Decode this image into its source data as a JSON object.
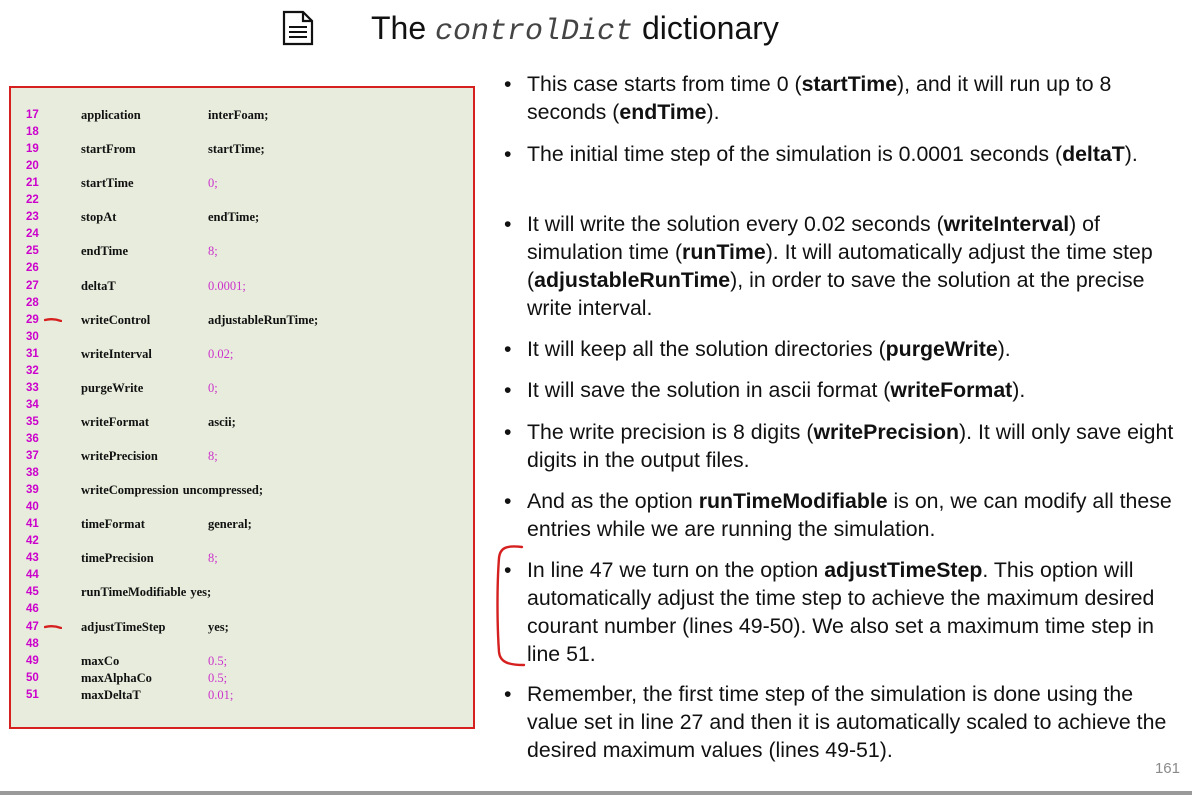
{
  "title": {
    "prefix": "The",
    "mono": "controlDict",
    "suffix": "dictionary"
  },
  "icons": {
    "title_icon": "document-icon"
  },
  "colors": {
    "accent_border": "#d62020",
    "line_number": "#cc00cc",
    "numeric_value": "#cc33cc",
    "code_background": "#e7ecdc"
  },
  "code": [
    {
      "n": "17",
      "key": "application",
      "value": "interFoam;",
      "numeric": false
    },
    {
      "n": "18",
      "key": "",
      "value": "",
      "numeric": false
    },
    {
      "n": "19",
      "key": "startFrom",
      "value": "startTime;",
      "numeric": false
    },
    {
      "n": "20",
      "key": "",
      "value": "",
      "numeric": false
    },
    {
      "n": "21",
      "key": "startTime",
      "value": "0;",
      "numeric": true
    },
    {
      "n": "22",
      "key": "",
      "value": "",
      "numeric": false
    },
    {
      "n": "23",
      "key": "stopAt",
      "value": "endTime;",
      "numeric": false
    },
    {
      "n": "24",
      "key": "",
      "value": "",
      "numeric": false
    },
    {
      "n": "25",
      "key": "endTime",
      "value": "8;",
      "numeric": true
    },
    {
      "n": "26",
      "key": "",
      "value": "",
      "numeric": false
    },
    {
      "n": "27",
      "key": "deltaT",
      "value": "0.0001;",
      "numeric": true
    },
    {
      "n": "28",
      "key": "",
      "value": "",
      "numeric": false
    },
    {
      "n": "29",
      "key": "writeControl",
      "value": "adjustableRunTime;",
      "numeric": false,
      "marked": true
    },
    {
      "n": "30",
      "key": "",
      "value": "",
      "numeric": false
    },
    {
      "n": "31",
      "key": "writeInterval",
      "value": "0.02;",
      "numeric": true
    },
    {
      "n": "32",
      "key": "",
      "value": "",
      "numeric": false
    },
    {
      "n": "33",
      "key": "purgeWrite",
      "value": "0;",
      "numeric": true
    },
    {
      "n": "34",
      "key": "",
      "value": "",
      "numeric": false
    },
    {
      "n": "35",
      "key": "writeFormat",
      "value": "ascii;",
      "numeric": false
    },
    {
      "n": "36",
      "key": "",
      "value": "",
      "numeric": false
    },
    {
      "n": "37",
      "key": "writePrecision",
      "value": "8;",
      "numeric": true
    },
    {
      "n": "38",
      "key": "",
      "value": "",
      "numeric": false
    },
    {
      "n": "39",
      "key": "writeCompression",
      "value": "uncompressed;",
      "numeric": false,
      "inline": true
    },
    {
      "n": "40",
      "key": "",
      "value": "",
      "numeric": false
    },
    {
      "n": "41",
      "key": "timeFormat",
      "value": "general;",
      "numeric": false
    },
    {
      "n": "42",
      "key": "",
      "value": "",
      "numeric": false
    },
    {
      "n": "43",
      "key": "timePrecision",
      "value": "8;",
      "numeric": true
    },
    {
      "n": "44",
      "key": "",
      "value": "",
      "numeric": false
    },
    {
      "n": "45",
      "key": "runTimeModifiable",
      "value": "yes;",
      "numeric": false,
      "inline": true
    },
    {
      "n": "46",
      "key": "",
      "value": "",
      "numeric": false
    },
    {
      "n": "47",
      "key": "adjustTimeStep",
      "value": "yes;",
      "numeric": false,
      "marked": true
    },
    {
      "n": "48",
      "key": "",
      "value": "",
      "numeric": false
    },
    {
      "n": "49",
      "key": "maxCo",
      "value": "0.5;",
      "numeric": true
    },
    {
      "n": "50",
      "key": "maxAlphaCo",
      "value": "0.5;",
      "numeric": true
    },
    {
      "n": "51",
      "key": "maxDeltaT",
      "value": "0.01;",
      "numeric": true
    }
  ],
  "bullets": [
    {
      "parts": [
        [
          "This case starts from time 0 (",
          false
        ],
        [
          "startTime",
          true
        ],
        [
          "), and it will run up to 8 seconds (",
          false
        ],
        [
          "endTime",
          true
        ],
        [
          ").",
          false
        ]
      ]
    },
    {
      "parts": [
        [
          "The initial time step of the simulation is 0.0001 seconds (",
          false
        ],
        [
          "deltaT",
          true
        ],
        [
          ").",
          false
        ]
      ]
    },
    {
      "parts": [
        [
          "It will write the solution every 0.02 seconds (",
          false
        ],
        [
          "writeInterval",
          true
        ],
        [
          ") of simulation time (",
          false
        ],
        [
          "runTime",
          true
        ],
        [
          ").  It will automatically adjust the time step (",
          false
        ],
        [
          "adjustableRunTime",
          true
        ],
        [
          "), in order to save the solution at the precise write interval.",
          false
        ]
      ]
    },
    {
      "parts": [
        [
          "It will keep all the solution directories (",
          false
        ],
        [
          "purgeWrite",
          true
        ],
        [
          ").",
          false
        ]
      ]
    },
    {
      "parts": [
        [
          "It will save the solution in ascii format (",
          false
        ],
        [
          "writeFormat",
          true
        ],
        [
          ").",
          false
        ]
      ]
    },
    {
      "parts": [
        [
          "The write precision is  8 digits (",
          false
        ],
        [
          "writePrecision",
          true
        ],
        [
          "). It will only save eight digits in the output files.",
          false
        ]
      ]
    },
    {
      "parts": [
        [
          "And as the option ",
          false
        ],
        [
          "runTimeModifiable",
          true
        ],
        [
          " is on, we can modify all these entries while we are running the simulation.",
          false
        ]
      ]
    },
    {
      "parts": [
        [
          "In line 47 we turn on the option ",
          false
        ],
        [
          "adjustTimeStep",
          true
        ],
        [
          ". This option will automatically adjust the time step to achieve the maximum desired courant number (lines 49-50). We also set a maximum time step in line 51.",
          false
        ]
      ]
    },
    {
      "parts": [
        [
          "Remember, the first time step of the simulation is done using the value set in line 27 and then it is automatically scaled to achieve the desired maximum values (lines 49-51).",
          false
        ]
      ]
    }
  ],
  "bullet_symbol": "•",
  "page_number": "161"
}
